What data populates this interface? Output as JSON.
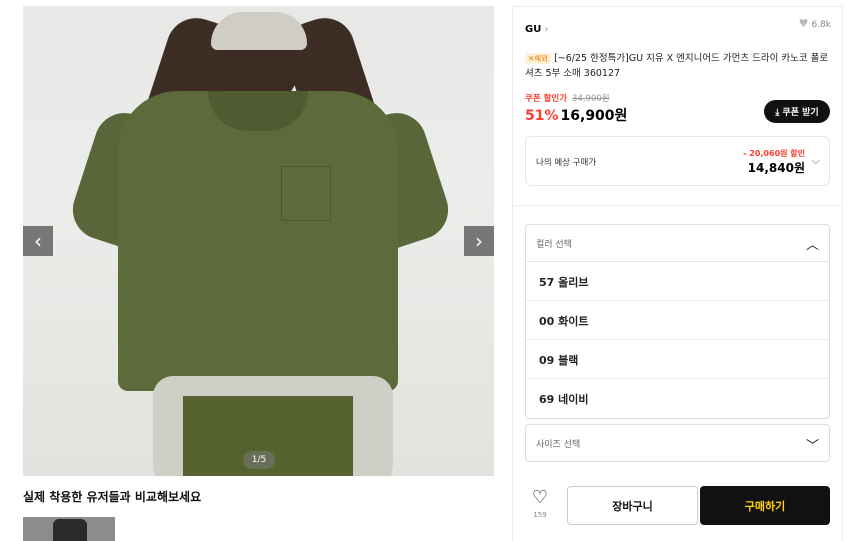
{
  "gallery": {
    "prev_icon": "chevron-left-icon",
    "next_icon": "chevron-right-icon",
    "counter": "1/5",
    "compare_title": "실제 착용한 유저들과 비교해보세요"
  },
  "product": {
    "brand": "GU",
    "brand_chevron": "›",
    "likes": "6.8k",
    "badge": "✕해외",
    "title": "[~6/25 한정특가]GU 지유 X 엔지니어드 가먼츠 드라이 카노코 폴로셔츠 5부 소매 360127",
    "coupon_label": "쿠폰 할인가",
    "original_price": "34,900원",
    "discount_rate": "51%",
    "price": "16,900원",
    "coupon_button": "⤓ 쿠폰 받기"
  },
  "estimate": {
    "label": "나의 예상 구매가",
    "discount_text": "- 20,060원 할인",
    "price": "14,840원"
  },
  "color_select": {
    "placeholder": "컬러 선택",
    "options": [
      "57 올리브",
      "00 화이트",
      "09 블랙",
      "69 네이비"
    ]
  },
  "size_select": {
    "placeholder": "사이즈 선택"
  },
  "actions": {
    "wish_count": "159",
    "cart_label": "장바구니",
    "buy_label": "구매하기"
  },
  "colors": {
    "accent_red": "#ff3b30",
    "buy_button_bg": "#111111",
    "buy_button_text": "#ffd400"
  }
}
